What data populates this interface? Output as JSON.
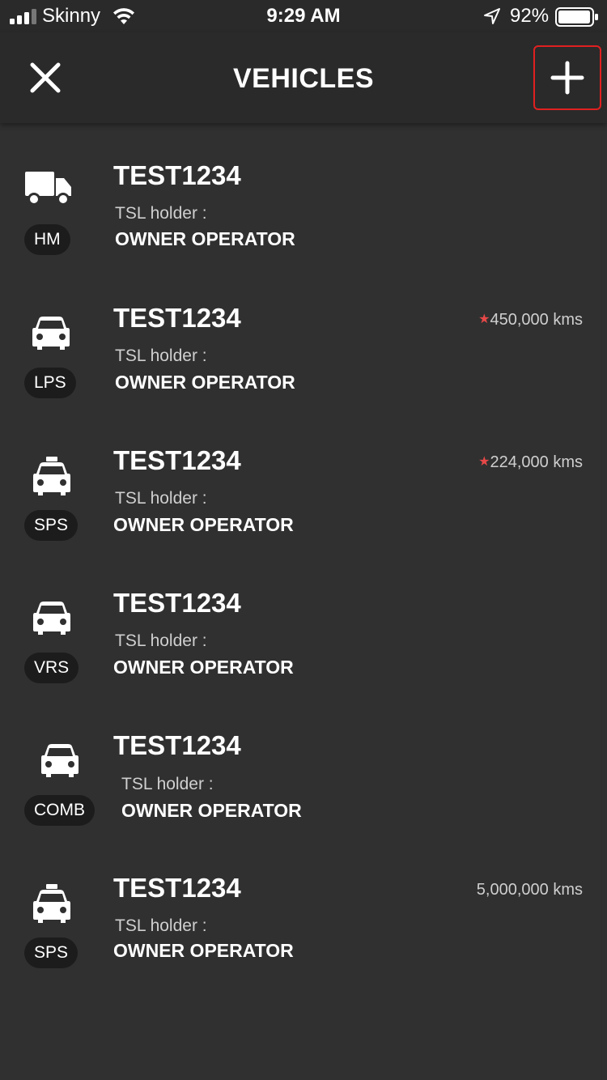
{
  "status_bar": {
    "carrier": "Skinny",
    "time": "9:29 AM",
    "battery_percent": "92%"
  },
  "nav": {
    "title": "VEHICLES"
  },
  "colors": {
    "background": "#303030",
    "bar": "#2a2a2a",
    "accent_red": "#e02020",
    "star": "#e84848"
  },
  "vehicles": [
    {
      "icon": "truck-icon",
      "badge": "HM",
      "plate": "TEST1234",
      "holder_label": "TSL holder :",
      "holder": "OWNER OPERATOR",
      "kms": "",
      "starred": false
    },
    {
      "icon": "car-icon",
      "badge": "LPS",
      "plate": "TEST1234",
      "holder_label": "TSL holder :",
      "holder": "OWNER OPERATOR",
      "kms": "450,000 kms",
      "starred": true
    },
    {
      "icon": "taxi-icon",
      "badge": "SPS",
      "plate": "TEST1234",
      "holder_label": "TSL holder :",
      "holder": "OWNER OPERATOR",
      "kms": "224,000 kms",
      "starred": true
    },
    {
      "icon": "car-icon",
      "badge": "VRS",
      "plate": "TEST1234",
      "holder_label": "TSL holder :",
      "holder": "OWNER OPERATOR",
      "kms": "",
      "starred": false
    },
    {
      "icon": "car-icon",
      "badge": "COMB",
      "plate": "TEST1234",
      "holder_label": "TSL holder :",
      "holder": "OWNER OPERATOR",
      "kms": "",
      "starred": false
    },
    {
      "icon": "taxi-icon",
      "badge": "SPS",
      "plate": "TEST1234",
      "holder_label": "TSL holder :",
      "holder": "OWNER OPERATOR",
      "kms": "5,000,000 kms",
      "starred": false
    }
  ]
}
